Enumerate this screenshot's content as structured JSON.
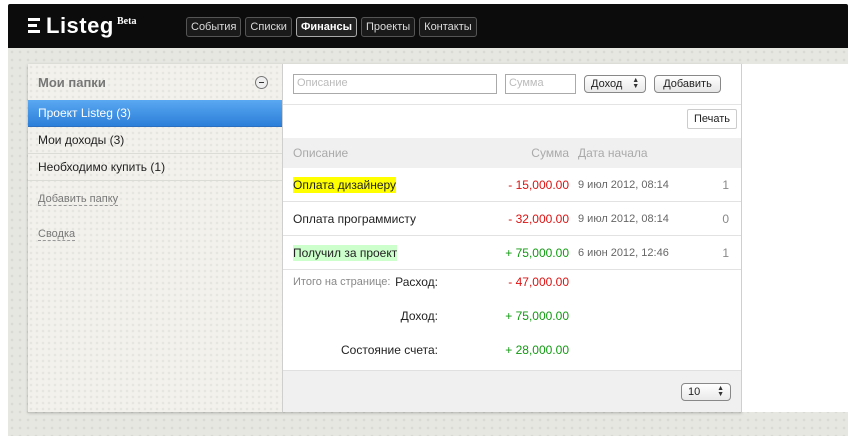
{
  "brand": {
    "name": "Listeg",
    "badge": "Beta"
  },
  "nav": [
    {
      "label": "События",
      "active": false
    },
    {
      "label": "Списки",
      "active": false
    },
    {
      "label": "Финансы",
      "active": true
    },
    {
      "label": "Проекты",
      "active": false
    },
    {
      "label": "Контакты",
      "active": false
    }
  ],
  "sidebar": {
    "title": "Мои папки",
    "folders": [
      {
        "label": "Проект Listeg (3)",
        "active": true
      },
      {
        "label": "Мои доходы (3)",
        "active": false
      },
      {
        "label": "Необходимо купить (1)",
        "active": false
      }
    ],
    "add_folder": "Добавить папку",
    "summary": "Сводка"
  },
  "form": {
    "description_placeholder": "Описание",
    "amount_placeholder": "Сумма",
    "type_value": "Доход",
    "add_label": "Добавить"
  },
  "print_label": "Печать",
  "table": {
    "headers": {
      "description": "Описание",
      "amount": "Сумма",
      "date": "Дата начала"
    },
    "rows": [
      {
        "description": "Оплата дизайнеру",
        "amount": "- 15,000.00",
        "date": "9 июл 2012, 08:14",
        "count": "1",
        "highlight": "#ffff00",
        "sign": "neg"
      },
      {
        "description": "Оплата программисту",
        "amount": "- 32,000.00",
        "date": "9 июл 2012, 08:14",
        "count": "0",
        "highlight": "",
        "sign": "neg"
      },
      {
        "description": "Получил за проект",
        "amount": "+ 75,000.00",
        "date": "6 июн 2012, 12:46",
        "count": "1",
        "highlight": "#ccffcc",
        "sign": "pos"
      }
    ]
  },
  "totals": {
    "page_note": "Итого на странице:",
    "expense_label": "Расход:",
    "expense_value": "- 47,000.00",
    "income_label": "Доход:",
    "income_value": "+ 75,000.00",
    "balance_label": "Состояние счета:",
    "balance_value": "+ 28,000.00"
  },
  "pager": {
    "per_page": "10"
  },
  "colors": {
    "negative": "#dd1111",
    "positive": "#119911",
    "active_folder": "#2c7fd9"
  }
}
